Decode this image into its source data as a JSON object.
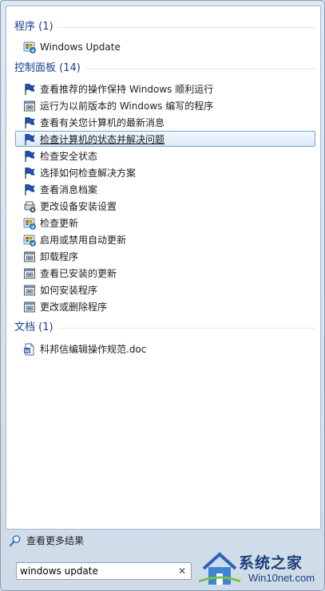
{
  "groups": {
    "programs": {
      "header": "程序 (1)",
      "items": [
        {
          "label": "Windows Update",
          "icon": "windows-update-icon"
        }
      ]
    },
    "control_panel": {
      "header": "控制面板 (14)",
      "items": [
        {
          "label": "查看推荐的操作保持 Windows 顺利运行",
          "icon": "flag-icon"
        },
        {
          "label": "运行为以前版本的 Windows 编写的程序",
          "icon": "program-icon"
        },
        {
          "label": "查看有关您计算机的最新消息",
          "icon": "flag-icon"
        },
        {
          "label": "检查计算机的状态并解决问题",
          "icon": "flag-icon",
          "selected": true
        },
        {
          "label": "检查安全状态",
          "icon": "flag-icon"
        },
        {
          "label": "选择如何检查解决方案",
          "icon": "flag-icon"
        },
        {
          "label": "查看消息档案",
          "icon": "flag-icon"
        },
        {
          "label": "更改设备安装设置",
          "icon": "device-icon"
        },
        {
          "label": "检查更新",
          "icon": "windows-update-icon"
        },
        {
          "label": "启用或禁用自动更新",
          "icon": "windows-update-icon"
        },
        {
          "label": "卸载程序",
          "icon": "program-icon"
        },
        {
          "label": "查看已安装的更新",
          "icon": "program-icon"
        },
        {
          "label": "如何安装程序",
          "icon": "program-icon"
        },
        {
          "label": "更改或删除程序",
          "icon": "program-icon"
        }
      ]
    },
    "documents": {
      "header": "文档 (1)",
      "items": [
        {
          "label": "科邦信编辑操作规范.doc",
          "icon": "word-document-icon"
        }
      ]
    }
  },
  "see_more": {
    "label": "查看更多结果",
    "icon": "search-icon"
  },
  "search": {
    "value": "windows update",
    "clear_icon": "close-icon"
  },
  "watermark": {
    "title": "系统之家",
    "subtitle": "Win10net.com"
  },
  "colors": {
    "header": "#1a3e8f",
    "selection_border": "#7da2ce",
    "flag": "#1f4fb8"
  }
}
